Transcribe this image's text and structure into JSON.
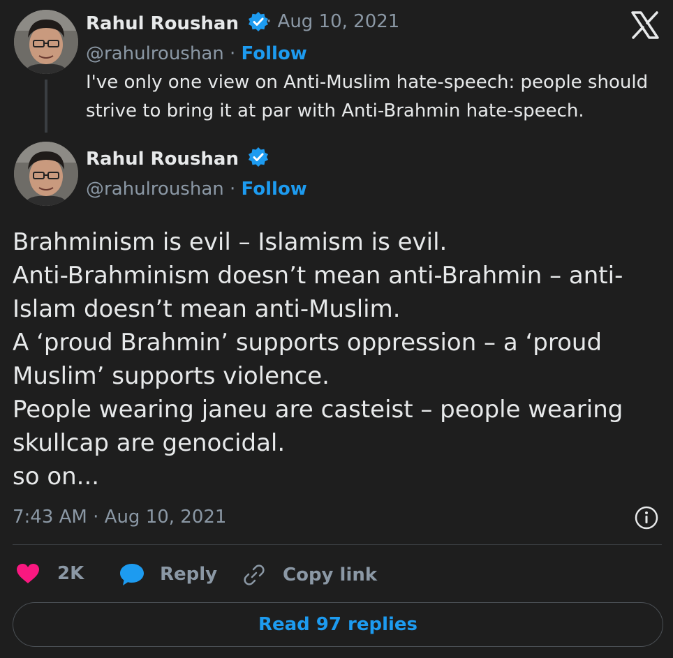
{
  "parent_tweet": {
    "author_name": "Rahul Roushan",
    "timestamp": "· Aug 10, 2021",
    "handle": "@rahulroushan",
    "separator": "·",
    "follow_label": "Follow",
    "text_lines": [
      "I've only one view on Anti-Muslim hate-speech: people should",
      "strive to bring it at par with Anti-Brahmin hate-speech."
    ]
  },
  "main_tweet": {
    "author_name": "Rahul Roushan",
    "handle": "@rahulroushan",
    "separator": "·",
    "follow_label": "Follow",
    "text_lines": [
      "Brahminism is evil – Islamism is evil.",
      "Anti-Brahminism doesn’t mean anti-Brahmin – anti-",
      "Islam doesn’t mean anti-Muslim.",
      "A ‘proud Brahmin’ supports oppression – a ‘proud",
      "Muslim’ supports violence.",
      "People wearing janeu are casteist – people wearing",
      "skullcap are genocidal.",
      "so on..."
    ],
    "timestamp": "7:43 AM · Aug 10, 2021"
  },
  "actions": {
    "like_count": "2K",
    "reply_label": "Reply",
    "copy_link_label": "Copy link"
  },
  "read_replies_label": "Read 97 replies",
  "colors": {
    "background": "#1e1e1e",
    "accent": "#1d9bf0",
    "like": "#f91880",
    "muted": "#8b98a5"
  },
  "icons": [
    "x-logo-icon",
    "verified-badge-icon",
    "heart-icon",
    "reply-icon",
    "link-icon",
    "info-icon"
  ]
}
